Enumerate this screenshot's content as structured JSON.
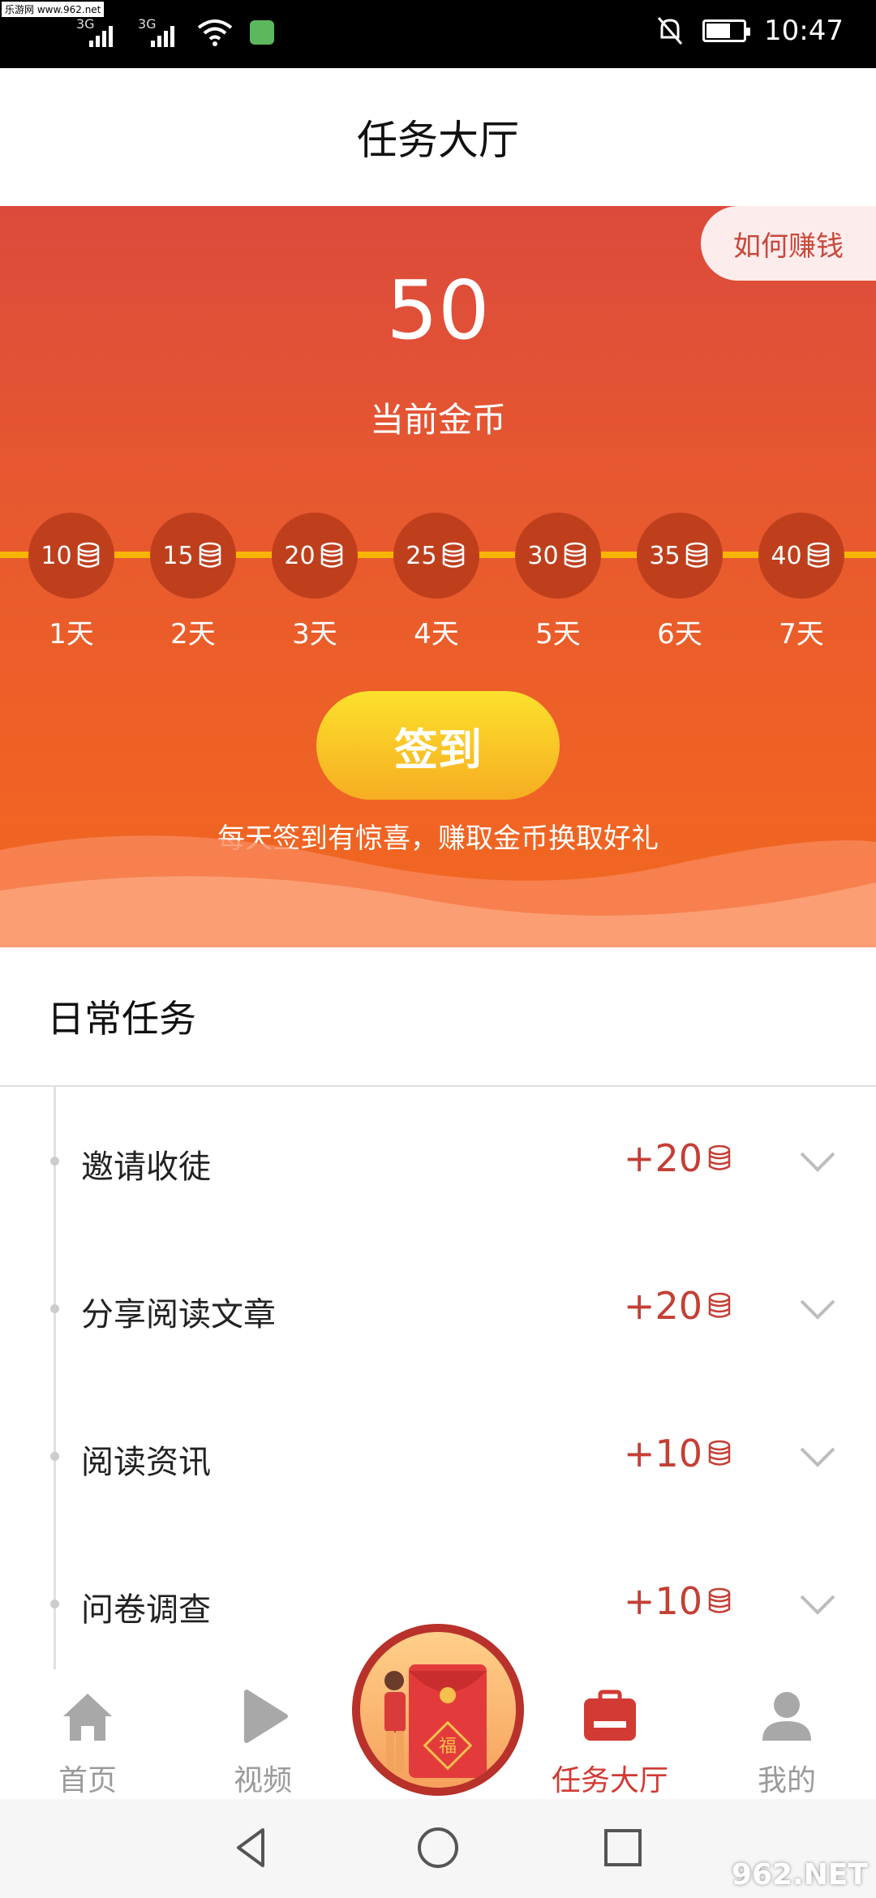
{
  "status_bar": {
    "time": "10:47",
    "network_1": "3G",
    "network_2": "3G",
    "watermark": "乐游网 www.962.net"
  },
  "header": {
    "title": "任务大厅"
  },
  "hero": {
    "how_to_earn": "如何赚钱",
    "coins": "50",
    "coins_label": "当前金币",
    "days": [
      {
        "reward": "10",
        "label": "1天"
      },
      {
        "reward": "15",
        "label": "2天"
      },
      {
        "reward": "20",
        "label": "3天"
      },
      {
        "reward": "25",
        "label": "4天"
      },
      {
        "reward": "30",
        "label": "5天"
      },
      {
        "reward": "35",
        "label": "6天"
      },
      {
        "reward": "40",
        "label": "7天"
      }
    ],
    "signin_label": "签到",
    "hint": "每天签到有惊喜，赚取金币换取好礼"
  },
  "daily": {
    "title": "日常任务",
    "tasks": [
      {
        "name": "邀请收徒",
        "points": "+20"
      },
      {
        "name": "分享阅读文章",
        "points": "+20"
      },
      {
        "name": "阅读资讯",
        "points": "+10"
      },
      {
        "name": "问卷调查",
        "points": "+10"
      }
    ]
  },
  "bottom_nav": {
    "items": [
      {
        "label": "首页",
        "icon": "home-icon"
      },
      {
        "label": "视频",
        "icon": "play-icon"
      },
      {
        "label": "任务大厅",
        "icon": "briefcase-icon",
        "active": true
      },
      {
        "label": "我的",
        "icon": "user-icon"
      }
    ],
    "center_badge": "福"
  },
  "colors": {
    "accent_red": "#d23a33",
    "hero_top": "#dc4a3b",
    "hero_bottom": "#f3681f",
    "signin_yellow": "#fce12c",
    "track": "#f7b500"
  },
  "corner_watermark": "962.NET"
}
